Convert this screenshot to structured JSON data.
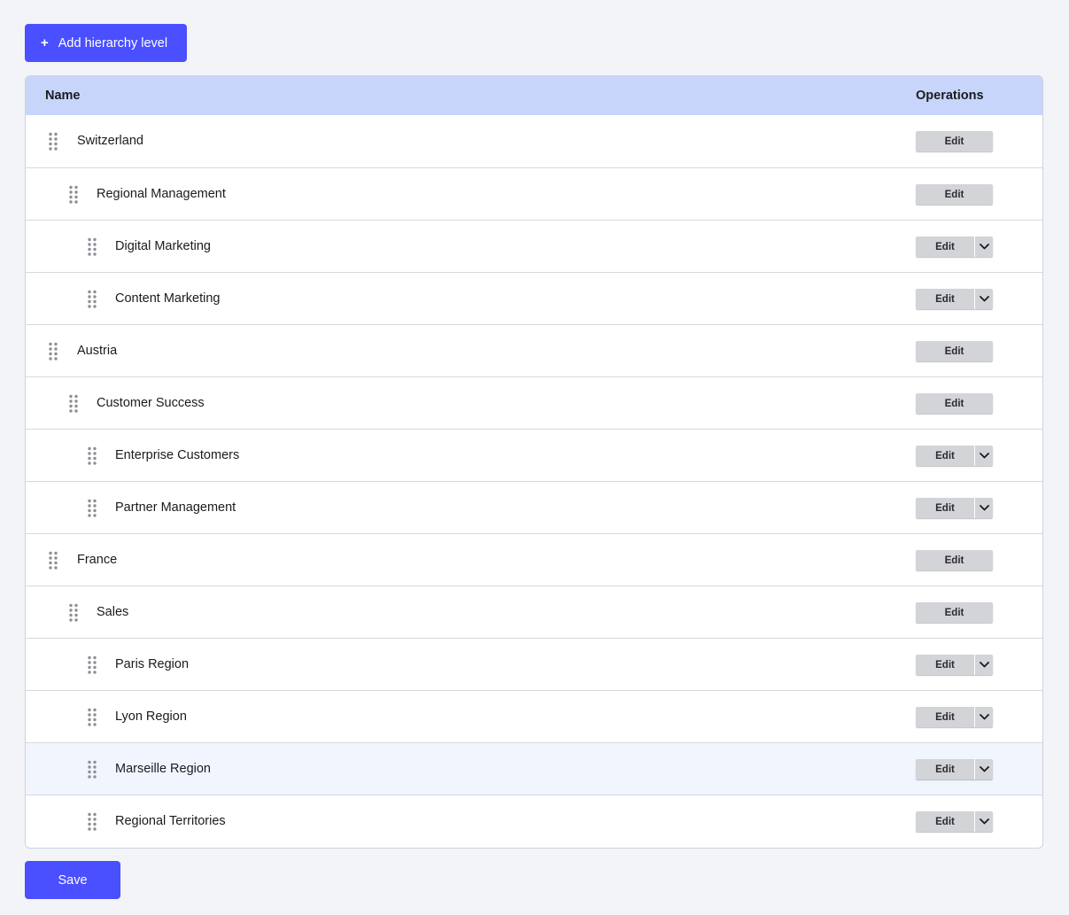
{
  "toolbar": {
    "add_icon": "plus-icon",
    "add_label": "Add hierarchy level"
  },
  "table": {
    "headers": {
      "name": "Name",
      "operations": "Operations"
    },
    "rows": [
      {
        "label": "Switzerland",
        "level": 0,
        "edit_label": "Edit",
        "has_dropdown": false
      },
      {
        "label": "Regional Management",
        "level": 1,
        "edit_label": "Edit",
        "has_dropdown": false
      },
      {
        "label": "Digital Marketing",
        "level": 2,
        "edit_label": "Edit",
        "has_dropdown": true
      },
      {
        "label": "Content Marketing",
        "level": 2,
        "edit_label": "Edit",
        "has_dropdown": true
      },
      {
        "label": "Austria",
        "level": 0,
        "edit_label": "Edit",
        "has_dropdown": false
      },
      {
        "label": "Customer Success",
        "level": 1,
        "edit_label": "Edit",
        "has_dropdown": false
      },
      {
        "label": "Enterprise Customers",
        "level": 2,
        "edit_label": "Edit",
        "has_dropdown": true
      },
      {
        "label": "Partner Management",
        "level": 2,
        "edit_label": "Edit",
        "has_dropdown": true
      },
      {
        "label": "France",
        "level": 0,
        "edit_label": "Edit",
        "has_dropdown": false
      },
      {
        "label": "Sales",
        "level": 1,
        "edit_label": "Edit",
        "has_dropdown": false
      },
      {
        "label": "Paris Region",
        "level": 2,
        "edit_label": "Edit",
        "has_dropdown": true
      },
      {
        "label": "Lyon Region",
        "level": 2,
        "edit_label": "Edit",
        "has_dropdown": true
      },
      {
        "label": "Marseille Region",
        "level": 2,
        "edit_label": "Edit",
        "has_dropdown": true,
        "hovered": true
      },
      {
        "label": "Regional Territories",
        "level": 2,
        "edit_label": "Edit",
        "has_dropdown": true
      }
    ]
  },
  "footer": {
    "save_label": "Save"
  },
  "colors": {
    "primary": "#4a4fff",
    "header_bg": "#c8d5fb",
    "hover_row_bg": "#f1f5fe",
    "button_gray": "#d3d4d8"
  },
  "icons": {
    "handle": "drag-handle-icon",
    "dropdown": "chevron-down-icon"
  }
}
